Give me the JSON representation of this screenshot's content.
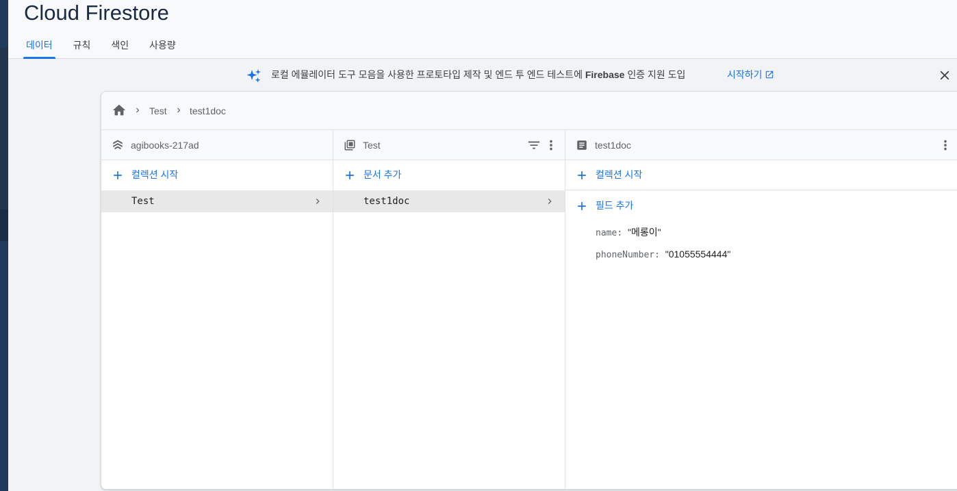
{
  "app": {
    "title": "Cloud Firestore"
  },
  "tabs": [
    {
      "label": "데이터",
      "active": true
    },
    {
      "label": "규칙",
      "active": false
    },
    {
      "label": "색인",
      "active": false
    },
    {
      "label": "사용량",
      "active": false
    }
  ],
  "banner": {
    "text_before": "로컬 에뮬레이터 도구 모음을 사용한 프로토타입 제작 및 엔드 투 엔드 테스트에 ",
    "text_bold": "Firebase",
    "text_after": " 인증 지원 도입",
    "link_label": "시작하기",
    "icons": {
      "sparkle": "sparkle-icon",
      "external": "open-in-new-icon",
      "close": "close-icon"
    }
  },
  "breadcrumb": {
    "items": [
      "Test",
      "test1doc"
    ],
    "icons": {
      "home": "home-icon",
      "separator": "chevron-right-icon"
    }
  },
  "columns": {
    "root": {
      "title": "agibooks-217ad",
      "icon": "firestore-stack-icon",
      "action_label": "컬렉션 시작",
      "items": [
        {
          "label": "Test",
          "selected": true
        }
      ]
    },
    "collection": {
      "title": "Test",
      "icon": "collection-icon",
      "action_label": "문서 추가",
      "items": [
        {
          "label": "test1doc",
          "selected": true
        }
      ]
    },
    "document": {
      "title": "test1doc",
      "icon": "document-icon",
      "collection_action_label": "컬렉션 시작",
      "field_action_label": "필드 추가",
      "fields": [
        {
          "key": "name",
          "value": "\"메롱이\""
        },
        {
          "key": "phoneNumber",
          "value": "\"01055554444\""
        }
      ]
    }
  },
  "colors": {
    "accent": "#1a73e8",
    "title": "#1a2a44",
    "selected_row": "#e8e8e8",
    "sparkle": "#1a73e8"
  }
}
